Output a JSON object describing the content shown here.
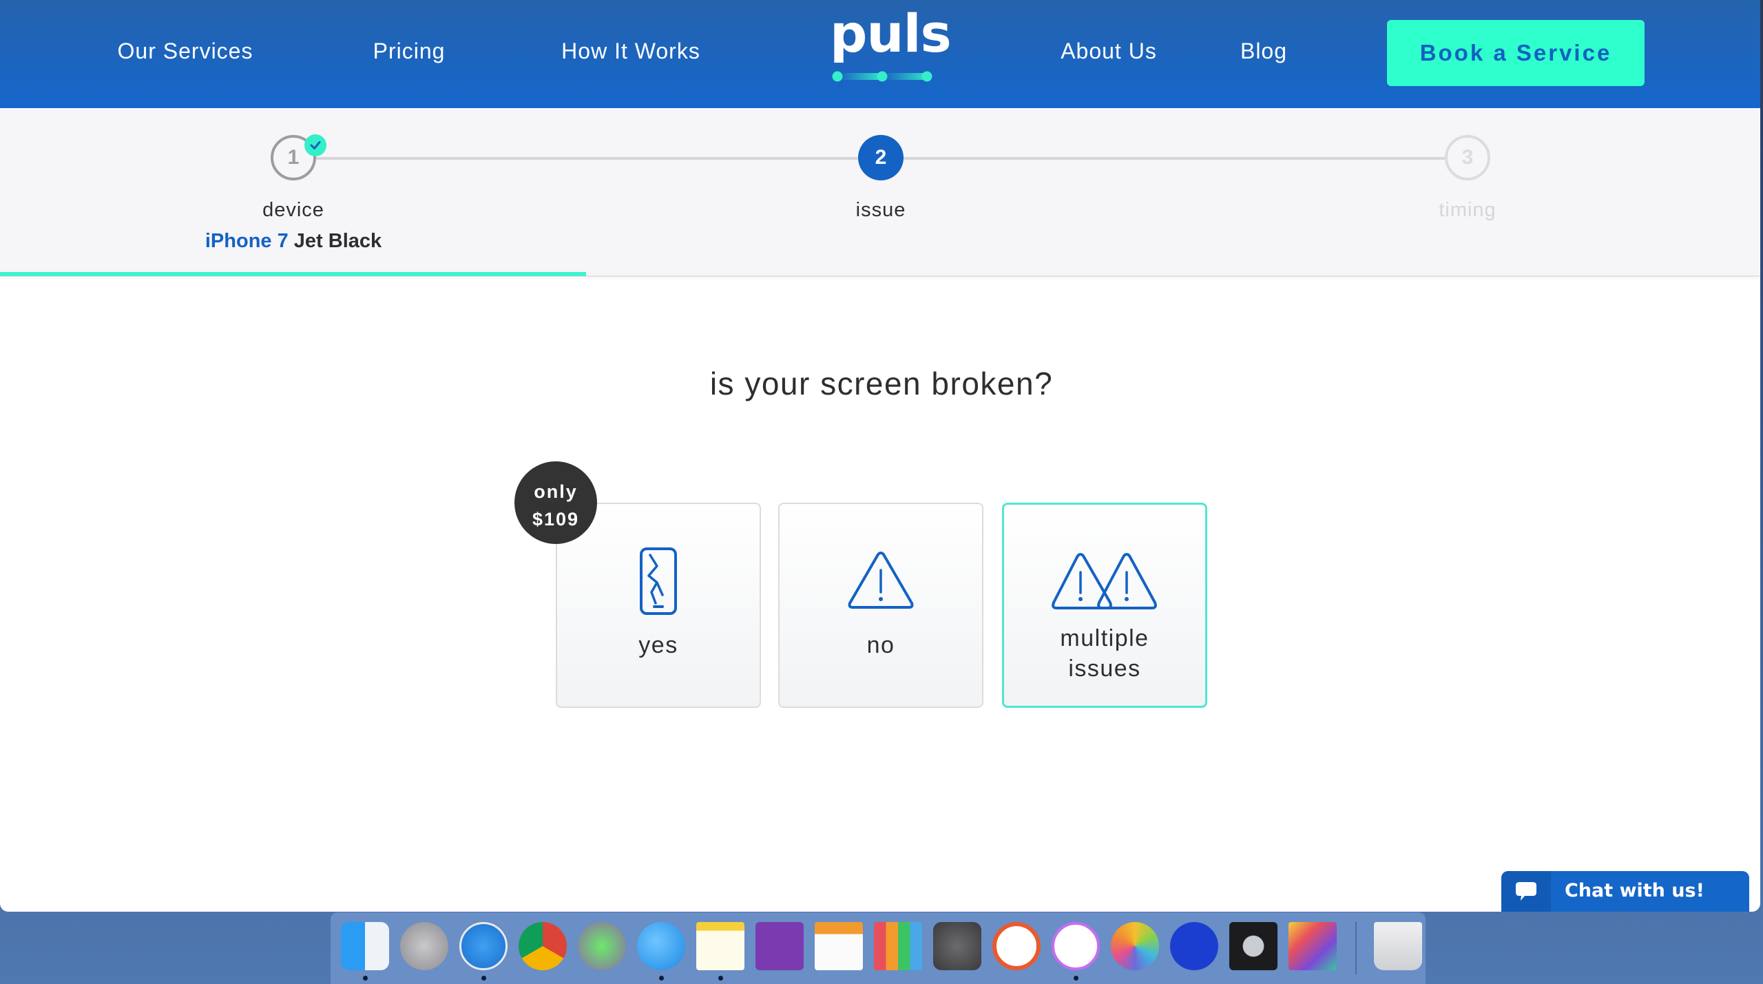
{
  "header": {
    "nav_left": [
      "Our Services",
      "Pricing",
      "How It Works"
    ],
    "logo": "puls",
    "nav_right": [
      "About Us",
      "Blog"
    ],
    "book_button": "Book a Service"
  },
  "stepper": {
    "steps": [
      {
        "number": "1",
        "label": "device",
        "state": "completed"
      },
      {
        "number": "2",
        "label": "issue",
        "state": "active"
      },
      {
        "number": "3",
        "label": "timing",
        "state": "upcoming"
      }
    ],
    "device_selection": {
      "model": "iPhone 7",
      "color": "Jet Black"
    },
    "progress_fraction": 0.333
  },
  "question": {
    "title": "is your screen broken?",
    "options": [
      {
        "label": "yes",
        "icon": "cracked-phone-icon",
        "selected": false
      },
      {
        "label": "no",
        "icon": "warning-icon",
        "selected": false
      },
      {
        "label_line1": "multiple",
        "label_line2": "issues",
        "icon": "double-warning-icon",
        "selected": true
      }
    ],
    "price_badge": {
      "line1": "only",
      "line2": "$109"
    }
  },
  "chat": {
    "label": "Chat with us!"
  },
  "dock": {
    "apps": [
      {
        "name": "Finder",
        "running": true
      },
      {
        "name": "Launchpad",
        "running": false
      },
      {
        "name": "Safari",
        "running": true
      },
      {
        "name": "Chrome",
        "running": false
      },
      {
        "name": "Tor Browser",
        "running": false
      },
      {
        "name": "Messages",
        "running": true
      },
      {
        "name": "Notes",
        "running": true
      },
      {
        "name": "OneNote",
        "running": false
      },
      {
        "name": "Pages",
        "running": false
      },
      {
        "name": "Numbers",
        "running": false
      },
      {
        "name": "System Preferences",
        "running": false
      },
      {
        "name": "Timing",
        "running": false
      },
      {
        "name": "iTunes",
        "running": true
      },
      {
        "name": "Photos",
        "running": false
      },
      {
        "name": "Screen Recorder",
        "running": false
      },
      {
        "name": "Logic Pro",
        "running": false
      },
      {
        "name": "Final Cut Pro",
        "running": false
      },
      {
        "name": "Trash",
        "running": false
      }
    ]
  },
  "colors": {
    "brand_blue": "#1566cc",
    "accent_mint": "#2effcd",
    "selected_border": "#4fe6d1",
    "text_dark": "#2e2e30"
  }
}
